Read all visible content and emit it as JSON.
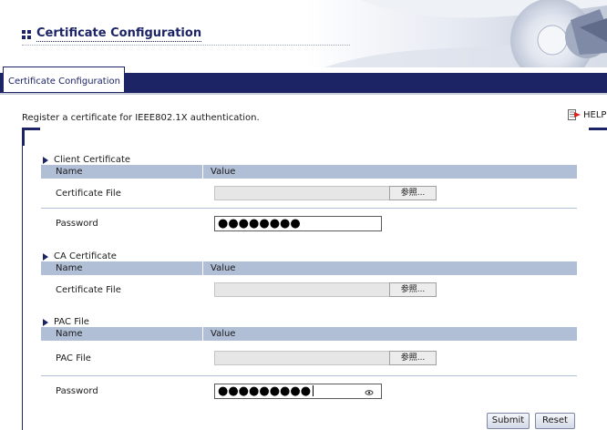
{
  "header": {
    "title": "Certificate Configuration"
  },
  "tabs": [
    {
      "label": "Certificate Configuration"
    }
  ],
  "description": "Register a certificate for IEEE802.1X authentication.",
  "help_label": "HELP",
  "columns": {
    "name": "Name",
    "value": "Value"
  },
  "sections": {
    "client": {
      "title": "Client Certificate",
      "rows": [
        {
          "name": "Certificate File",
          "browse_label": "参照..."
        },
        {
          "name": "Password",
          "value": "●●●●●●●●"
        }
      ]
    },
    "ca": {
      "title": "CA Certificate",
      "rows": [
        {
          "name": "Certificate File",
          "browse_label": "参照..."
        }
      ]
    },
    "pac": {
      "title": "PAC File",
      "rows": [
        {
          "name": "PAC File",
          "browse_label": "参照..."
        },
        {
          "name": "Password",
          "value": "●●●●●●●●●"
        }
      ]
    }
  },
  "buttons": {
    "submit": "Submit",
    "reset": "Reset"
  },
  "colors": {
    "navy": "#1c2466",
    "table_header": "#b1bfd6"
  }
}
